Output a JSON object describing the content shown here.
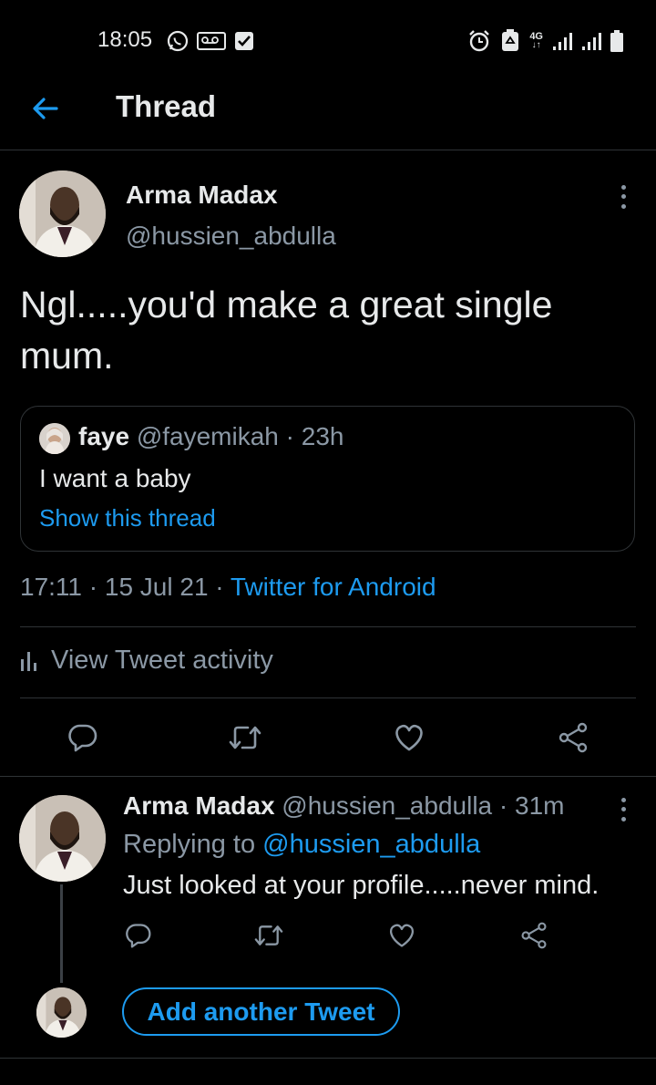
{
  "status_bar": {
    "time": "18:05",
    "left_icons": [
      "whatsapp-icon",
      "voicemail-icon",
      "checkbox-icon"
    ],
    "right_icons": [
      "alarm-icon",
      "recycle-icon",
      "network-4g-icon",
      "signal-icon",
      "signal-icon",
      "battery-icon"
    ],
    "network_label": "4G"
  },
  "header": {
    "title": "Thread",
    "back_icon": "back-arrow-icon"
  },
  "main_tweet": {
    "name": "Arma Madax",
    "handle": "@hussien_abdulla",
    "text": "Ngl.....you'd make a great single mum.",
    "quote": {
      "name": "faye",
      "handle": "@fayemikah",
      "time": "· 23h",
      "text": "I want a baby",
      "link": "Show this thread"
    },
    "meta_time": "17:11 · 15 Jul 21 ·",
    "meta_source": "Twitter for Android",
    "activity": "View Tweet activity"
  },
  "reply_tweet": {
    "name": "Arma Madax",
    "handle": "@hussien_abdulla",
    "time": "· 31m",
    "replying_prefix": "Replying to",
    "replying_handle": "@hussien_abdulla",
    "text": "Just looked at your profile.....never mind."
  },
  "add_button": "Add another Tweet",
  "colors": {
    "background": "#000000",
    "accent": "#1d9bf0",
    "secondary_text": "#8b98a5",
    "divider": "#2f3336"
  }
}
